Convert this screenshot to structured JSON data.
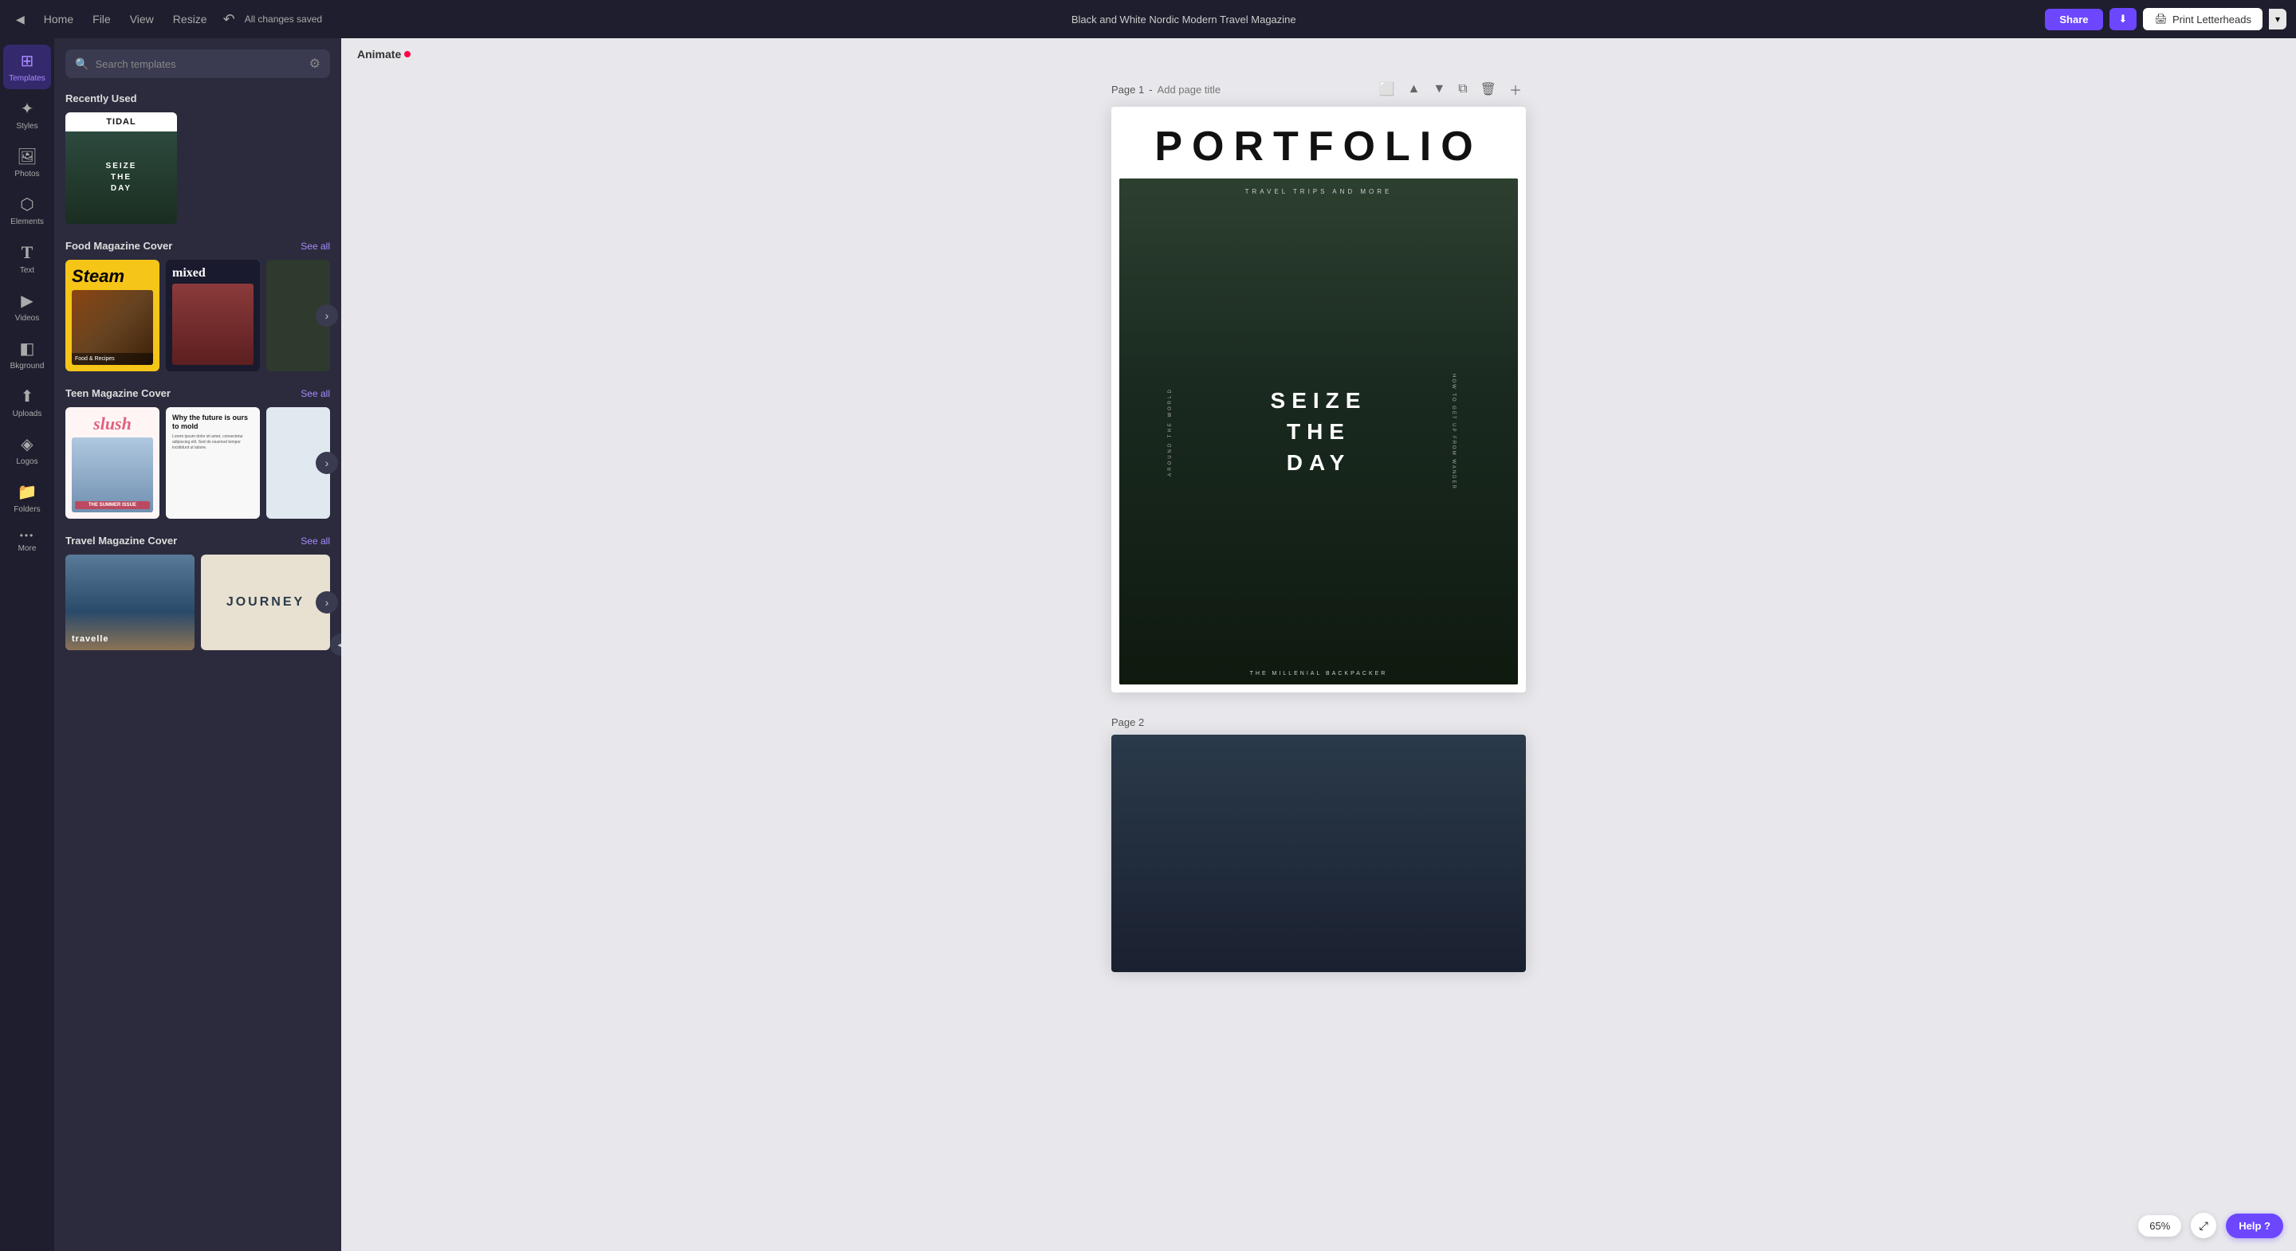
{
  "topbar": {
    "home_label": "Home",
    "file_label": "File",
    "view_label": "View",
    "resize_label": "Resize",
    "saved_label": "All changes saved",
    "title": "Black and White Nordic Modern Travel Magazine",
    "share_label": "Share",
    "download_icon": "⬇",
    "print_label": "Print Letterheads",
    "print_chevron": "▾"
  },
  "icon_sidebar": {
    "items": [
      {
        "id": "templates",
        "label": "Templates",
        "symbol": "⊞",
        "active": true
      },
      {
        "id": "styles",
        "label": "Styles",
        "symbol": "✦"
      },
      {
        "id": "photos",
        "label": "Photos",
        "symbol": "🖼"
      },
      {
        "id": "elements",
        "label": "Elements",
        "symbol": "⬡"
      },
      {
        "id": "text",
        "label": "Text",
        "symbol": "T"
      },
      {
        "id": "videos",
        "label": "Videos",
        "symbol": "▶"
      },
      {
        "id": "bkground",
        "label": "Bkground",
        "symbol": "◧"
      },
      {
        "id": "uploads",
        "label": "Uploads",
        "symbol": "⬆"
      },
      {
        "id": "logos",
        "label": "Logos",
        "symbol": "◈"
      },
      {
        "id": "folders",
        "label": "Folders",
        "symbol": "📁"
      },
      {
        "id": "more",
        "label": "More",
        "symbol": "···"
      }
    ]
  },
  "templates_panel": {
    "search_placeholder": "Search templates",
    "recently_used_label": "Recently Used",
    "sections": [
      {
        "id": "food-magazine",
        "title": "Food Magazine Cover",
        "see_all": "See all",
        "cards": [
          {
            "id": "steam",
            "title": "Steam",
            "bg": "#f5c518"
          },
          {
            "id": "mixed",
            "title": "mixed",
            "bg": "#1a1a2e"
          },
          {
            "id": "food3",
            "title": "",
            "bg": "#2d3a2d"
          }
        ]
      },
      {
        "id": "teen-magazine",
        "title": "Teen Magazine Cover",
        "see_all": "See all",
        "cards": [
          {
            "id": "slush",
            "title": "slush",
            "bg": "#fff5f5"
          },
          {
            "id": "future",
            "title": "Why the future is ours to mold",
            "bg": "#f8f8f8"
          },
          {
            "id": "teen3",
            "title": "",
            "bg": "#e0e8f0"
          }
        ]
      },
      {
        "id": "travel-magazine",
        "title": "Travel Magazine Cover",
        "see_all": "See all",
        "cards": [
          {
            "id": "travelle",
            "title": "travelle",
            "bg": "#7090b0"
          },
          {
            "id": "journey",
            "title": "JOURNEY",
            "bg": "#e8e0d0"
          }
        ]
      }
    ]
  },
  "animate_btn": "Animate",
  "page1": {
    "label": "Page 1",
    "title_placeholder": "Add page title",
    "portfolio_title": "PORTFOLIO",
    "travel_tagline": "TRAVEL TRIPS AND MORE",
    "seize_line1": "SEIZE",
    "seize_line2": "THE",
    "seize_line3": "DAY",
    "left_text": "AROUND THE WORLD",
    "right_text": "HOW TO GET UP FROM WANDER",
    "bottom_text": "THE MILLENIAL BACKPACKER"
  },
  "page2": {
    "label": "Page 2"
  },
  "zoom": {
    "level": "65%"
  },
  "help_label": "Help ?"
}
